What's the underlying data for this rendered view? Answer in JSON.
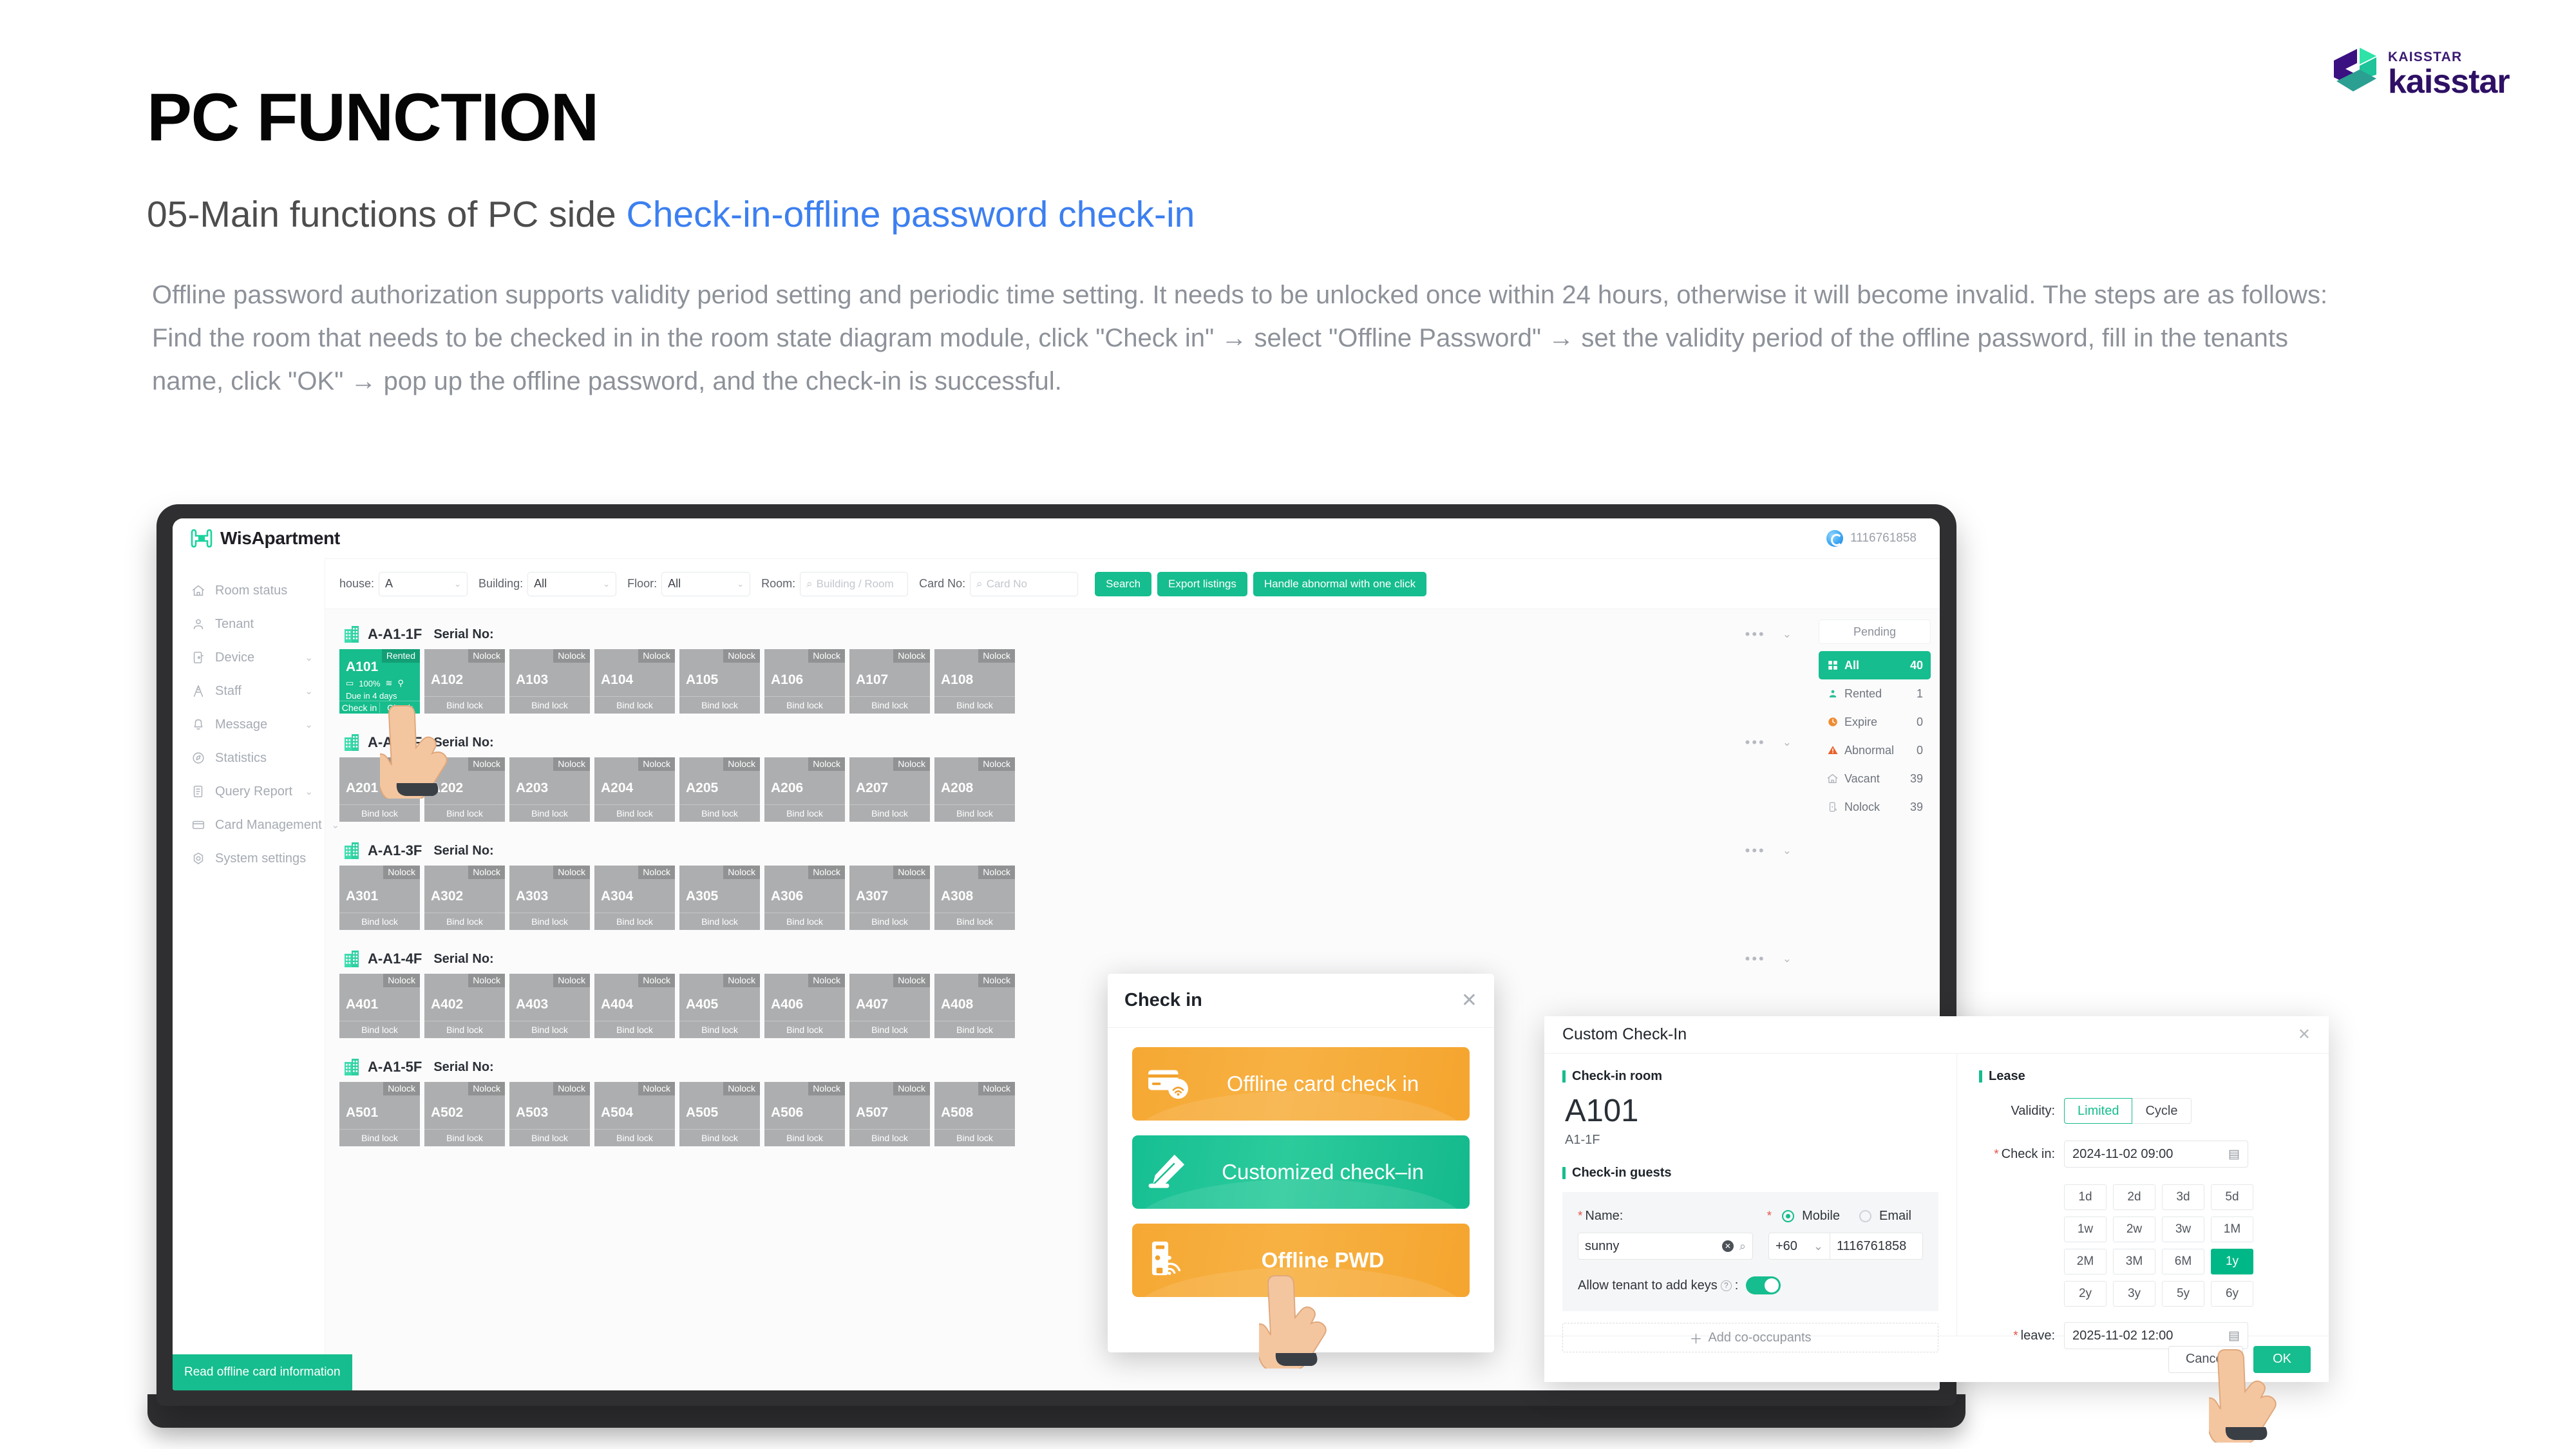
{
  "slide": {
    "title": "PC FUNCTION",
    "subtitle_plain": "05-Main functions of PC side ",
    "subtitle_highlight": "Check-in-offline password check-in",
    "paragraph": "Offline password authorization supports validity period setting and periodic time setting. It needs to be unlocked once within 24 hours, otherwise it will become invalid. The steps are as follows: Find the room that needs to be checked in in the room state diagram module, click \"Check in\" → select \"Offline Password\" → set the validity period of the offline password, fill in the tenants name, click \"OK\" → pop up the offline password, and the check-in is successful.",
    "accent_blue": "#3c7ff0",
    "accent_green": "#16bd8e"
  },
  "logo": {
    "small_text": "KAISSTAR",
    "big_text": "kaisstar",
    "purple": "#2e1065",
    "teal": "#2fd9a9"
  },
  "app": {
    "brand": "WisApartment",
    "account": "1116761858",
    "sidebar": [
      {
        "label": "Room status",
        "icon": "home-icon",
        "caret": ""
      },
      {
        "label": "Tenant",
        "icon": "user-icon",
        "caret": ""
      },
      {
        "label": "Device",
        "icon": "device-icon",
        "caret": "⌄"
      },
      {
        "label": "Staff",
        "icon": "staff-icon",
        "caret": "⌄"
      },
      {
        "label": "Message",
        "icon": "bell-icon",
        "caret": "⌄"
      },
      {
        "label": "Statistics",
        "icon": "statistics-icon",
        "caret": ""
      },
      {
        "label": "Query Report",
        "icon": "report-icon",
        "caret": "⌄"
      },
      {
        "label": "Card Management",
        "icon": "card-icon",
        "caret": "⌄"
      },
      {
        "label": "System settings",
        "icon": "settings-icon",
        "caret": ""
      }
    ],
    "filters": {
      "house_label": "house:",
      "house_value": "A",
      "building_label": "Building:",
      "building_value": "All",
      "floor_label": "Floor:",
      "floor_value": "All",
      "room_label": "Room:",
      "room_placeholder": "Building / Room",
      "card_label": "Card No:",
      "card_placeholder": "Card No",
      "search_btn": "Search",
      "export_btn": "Export listings",
      "abnormal_btn": "Handle abnormal with one click"
    },
    "serial_label": "Serial No:",
    "floors": [
      {
        "name": "A-A1-1F",
        "rooms": [
          {
            "no": "A101",
            "status": "Rented",
            "rented": true,
            "battery": "100%",
            "due": "Due in 4 days",
            "actions": [
              "Check in",
              "Check"
            ]
          },
          {
            "no": "A102",
            "status": "Nolock",
            "rented": false,
            "actions": [
              "Bind lock"
            ]
          },
          {
            "no": "A103",
            "status": "Nolock",
            "rented": false,
            "actions": [
              "Bind lock"
            ]
          },
          {
            "no": "A104",
            "status": "Nolock",
            "rented": false,
            "actions": [
              "Bind lock"
            ]
          },
          {
            "no": "A105",
            "status": "Nolock",
            "rented": false,
            "actions": [
              "Bind lock"
            ]
          },
          {
            "no": "A106",
            "status": "Nolock",
            "rented": false,
            "actions": [
              "Bind lock"
            ]
          },
          {
            "no": "A107",
            "status": "Nolock",
            "rented": false,
            "actions": [
              "Bind lock"
            ]
          },
          {
            "no": "A108",
            "status": "Nolock",
            "rented": false,
            "actions": [
              "Bind lock"
            ]
          }
        ]
      },
      {
        "name": "A-A1-2F",
        "rooms": [
          {
            "no": "A201",
            "status": "Nolock",
            "rented": false,
            "actions": [
              "Bind lock"
            ]
          },
          {
            "no": "A202",
            "status": "Nolock",
            "rented": false,
            "actions": [
              "Bind lock"
            ]
          },
          {
            "no": "A203",
            "status": "Nolock",
            "rented": false,
            "actions": [
              "Bind lock"
            ]
          },
          {
            "no": "A204",
            "status": "Nolock",
            "rented": false,
            "actions": [
              "Bind lock"
            ]
          },
          {
            "no": "A205",
            "status": "Nolock",
            "rented": false,
            "actions": [
              "Bind lock"
            ]
          },
          {
            "no": "A206",
            "status": "Nolock",
            "rented": false,
            "actions": [
              "Bind lock"
            ]
          },
          {
            "no": "A207",
            "status": "Nolock",
            "rented": false,
            "actions": [
              "Bind lock"
            ]
          },
          {
            "no": "A208",
            "status": "Nolock",
            "rented": false,
            "actions": [
              "Bind lock"
            ]
          }
        ]
      },
      {
        "name": "A-A1-3F",
        "rooms": [
          {
            "no": "A301",
            "status": "Nolock",
            "rented": false,
            "actions": [
              "Bind lock"
            ]
          },
          {
            "no": "A302",
            "status": "Nolock",
            "rented": false,
            "actions": [
              "Bind lock"
            ]
          },
          {
            "no": "A303",
            "status": "Nolock",
            "rented": false,
            "actions": [
              "Bind lock"
            ]
          },
          {
            "no": "A304",
            "status": "Nolock",
            "rented": false,
            "actions": [
              "Bind lock"
            ]
          },
          {
            "no": "A305",
            "status": "Nolock",
            "rented": false,
            "actions": [
              "Bind lock"
            ]
          },
          {
            "no": "A306",
            "status": "Nolock",
            "rented": false,
            "actions": [
              "Bind lock"
            ]
          },
          {
            "no": "A307",
            "status": "Nolock",
            "rented": false,
            "actions": [
              "Bind lock"
            ]
          },
          {
            "no": "A308",
            "status": "Nolock",
            "rented": false,
            "actions": [
              "Bind lock"
            ]
          }
        ]
      },
      {
        "name": "A-A1-4F",
        "rooms": [
          {
            "no": "A401",
            "status": "Nolock",
            "rented": false,
            "actions": [
              "Bind lock"
            ]
          },
          {
            "no": "A402",
            "status": "Nolock",
            "rented": false,
            "actions": [
              "Bind lock"
            ]
          },
          {
            "no": "A403",
            "status": "Nolock",
            "rented": false,
            "actions": [
              "Bind lock"
            ]
          },
          {
            "no": "A404",
            "status": "Nolock",
            "rented": false,
            "actions": [
              "Bind lock"
            ]
          },
          {
            "no": "A405",
            "status": "Nolock",
            "rented": false,
            "actions": [
              "Bind lock"
            ]
          },
          {
            "no": "A406",
            "status": "Nolock",
            "rented": false,
            "actions": [
              "Bind lock"
            ]
          },
          {
            "no": "A407",
            "status": "Nolock",
            "rented": false,
            "actions": [
              "Bind lock"
            ]
          },
          {
            "no": "A408",
            "status": "Nolock",
            "rented": false,
            "actions": [
              "Bind lock"
            ]
          }
        ]
      },
      {
        "name": "A-A1-5F",
        "rooms": [
          {
            "no": "A501",
            "status": "Nolock",
            "rented": false,
            "actions": [
              "Bind lock"
            ]
          },
          {
            "no": "A502",
            "status": "Nolock",
            "rented": false,
            "actions": [
              "Bind lock"
            ]
          },
          {
            "no": "A503",
            "status": "Nolock",
            "rented": false,
            "actions": [
              "Bind lock"
            ]
          },
          {
            "no": "A504",
            "status": "Nolock",
            "rented": false,
            "actions": [
              "Bind lock"
            ]
          },
          {
            "no": "A505",
            "status": "Nolock",
            "rented": false,
            "actions": [
              "Bind lock"
            ]
          },
          {
            "no": "A506",
            "status": "Nolock",
            "rented": false,
            "actions": [
              "Bind lock"
            ]
          },
          {
            "no": "A507",
            "status": "Nolock",
            "rented": false,
            "actions": [
              "Bind lock"
            ]
          },
          {
            "no": "A508",
            "status": "Nolock",
            "rented": false,
            "actions": [
              "Bind lock"
            ]
          }
        ]
      }
    ],
    "status_panel": {
      "pending": "Pending",
      "rows": [
        {
          "label": "All",
          "value": "40",
          "icon": "grid-icon",
          "selected": true
        },
        {
          "label": "Rented",
          "value": "1",
          "icon": "user-icon",
          "selected": false
        },
        {
          "label": "Expire",
          "value": "0",
          "icon": "clock-icon",
          "selected": false
        },
        {
          "label": "Abnormal",
          "value": "0",
          "icon": "warning-icon",
          "selected": false
        },
        {
          "label": "Vacant",
          "value": "39",
          "icon": "home-icon",
          "selected": false
        },
        {
          "label": "Nolock",
          "value": "39",
          "icon": "nolock-icon",
          "selected": false
        }
      ]
    },
    "read_card_btn": "Read offline card information"
  },
  "checkin_modal": {
    "title": "Check in",
    "close": "✕",
    "options": [
      {
        "label": "Offline card check in",
        "icon": "card-wifi-icon",
        "color": "orange",
        "bold": false
      },
      {
        "label": "Customized check–in",
        "icon": "pencil-icon",
        "color": "green",
        "bold": false
      },
      {
        "label": "Offline PWD",
        "icon": "lock-wifi-icon",
        "color": "orange",
        "bold": true
      }
    ]
  },
  "custom_checkin": {
    "title": "Custom Check-In",
    "close": "✕",
    "section_room": "Check-in room",
    "room_no": "A101",
    "room_sub": "A1-1F",
    "section_guests": "Check-in guests",
    "name_label": "Name:",
    "name_value": "sunny",
    "contact_mobile": "Mobile",
    "contact_email": "Email",
    "country_code": "+60",
    "phone_value": "1116761858",
    "allow_keys_label": "Allow tenant to add keys",
    "allow_keys_on": true,
    "add_cooccupants": "Add co-occupants",
    "section_lease": "Lease",
    "validity_label": "Validity:",
    "validity_options": [
      "Limited",
      "Cycle"
    ],
    "validity_selected": "Limited",
    "checkin_label": "Check in:",
    "checkin_value": "2024-11-02 09:00",
    "duration_chips": [
      "1d",
      "2d",
      "3d",
      "5d",
      "1w",
      "2w",
      "3w",
      "1M",
      "2M",
      "3M",
      "6M",
      "1y",
      "2y",
      "3y",
      "5y",
      "6y"
    ],
    "duration_selected": "1y",
    "leave_label": "leave:",
    "leave_value": "2025-11-02 12:00",
    "cancel_btn": "Cancel",
    "ok_btn": "OK"
  }
}
